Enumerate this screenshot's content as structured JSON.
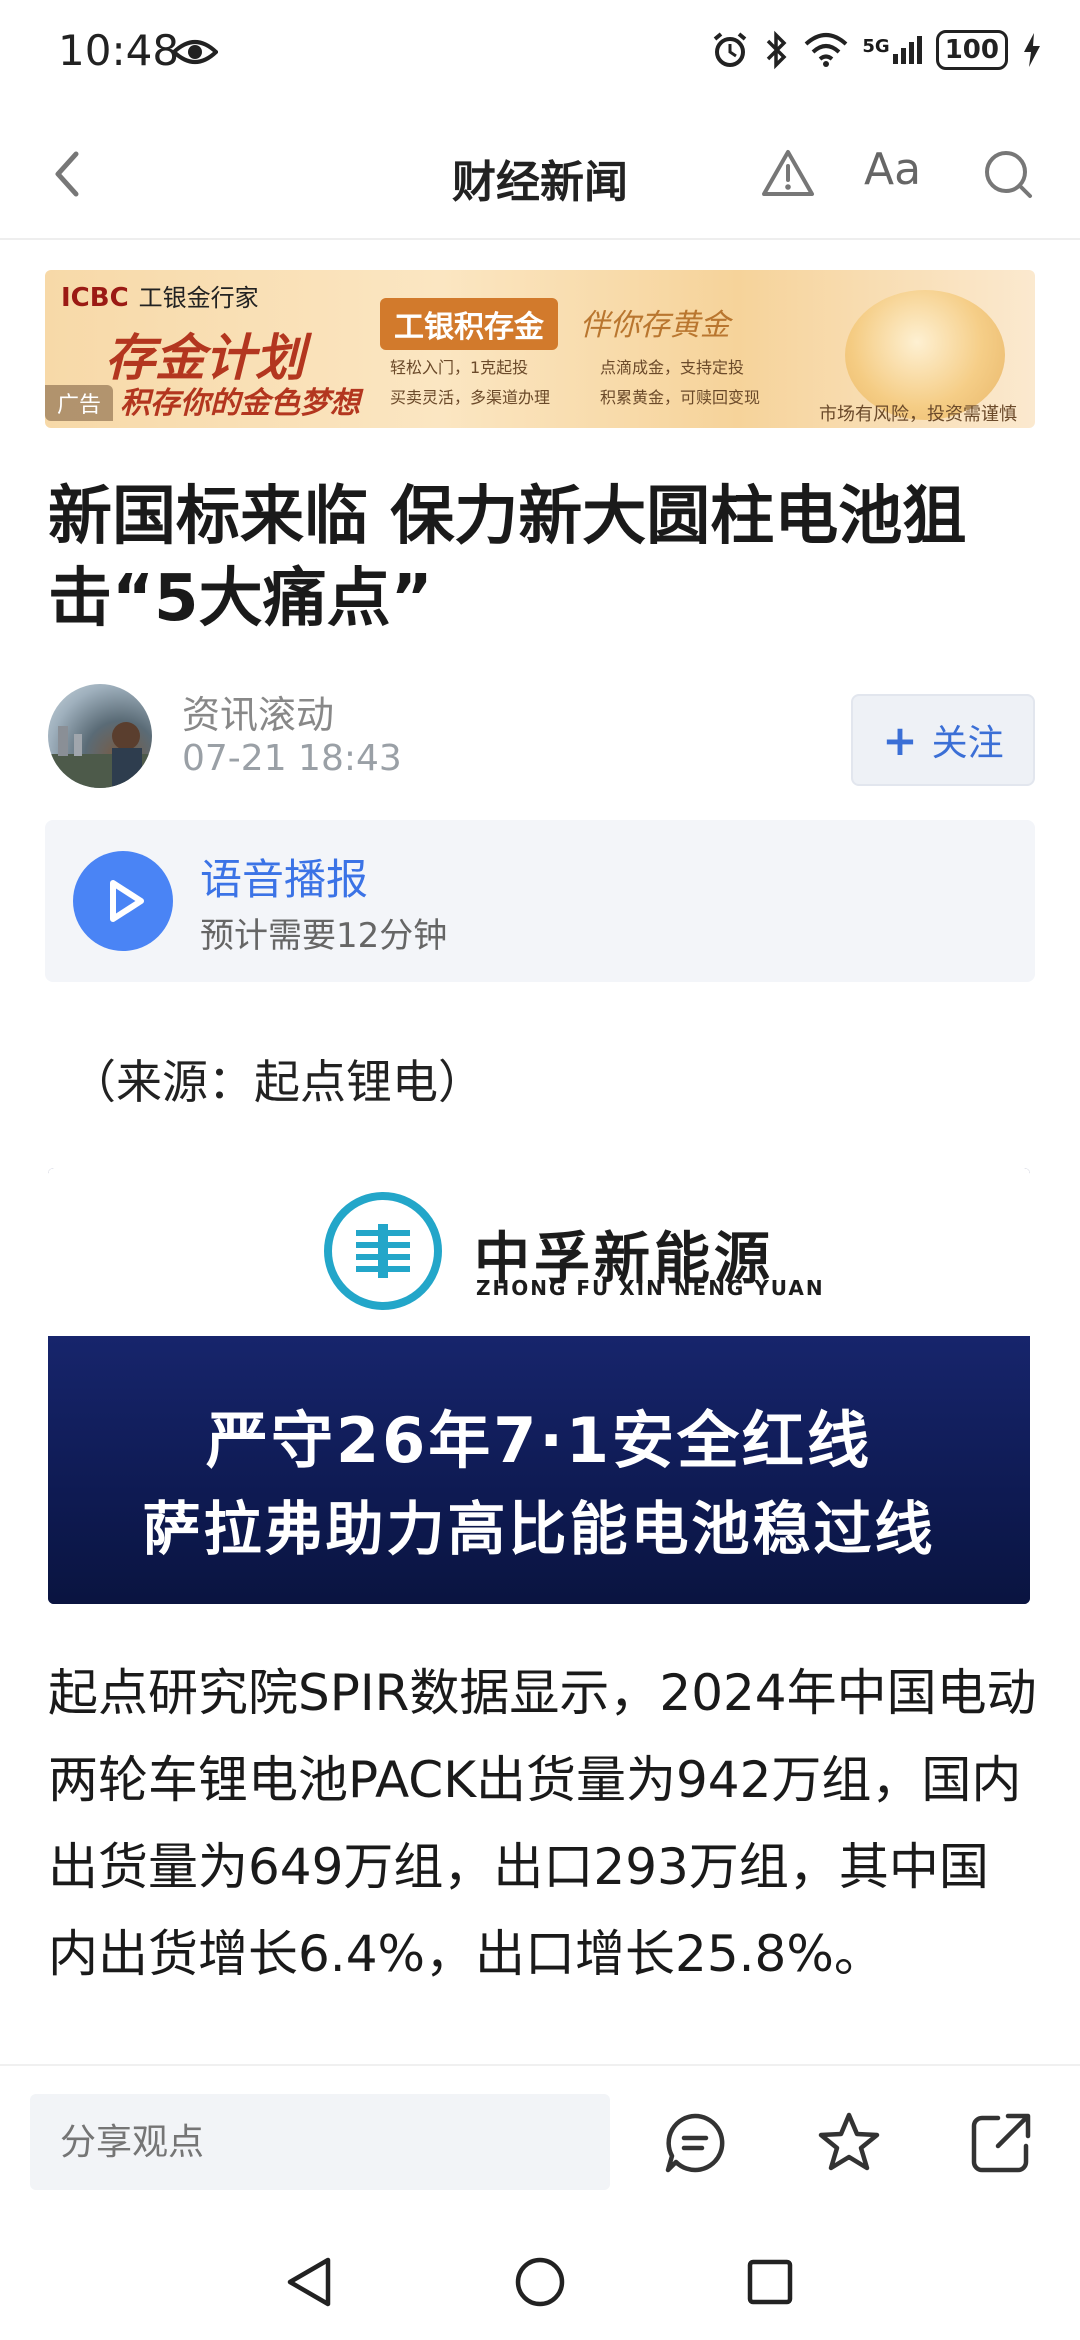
{
  "status_bar": {
    "time": "10:48",
    "network": "5G",
    "battery": "100"
  },
  "header": {
    "title": "财经新闻",
    "font_button": "Aa"
  },
  "ad": {
    "brand_en": "ICBC",
    "brand_cn": "工银金行家",
    "headline": "存金计划",
    "subline": "积存你的金色梦想",
    "tag": "广告",
    "product": "工银积存金",
    "slogan": "伴你存黄金",
    "bullets": [
      "轻松入门，1克起投",
      "点滴成金，支持定投",
      "买卖灵活，多渠道办理",
      "积累黄金，可赎回变现"
    ],
    "risk_note": "市场有风险，投资需谨慎"
  },
  "article": {
    "title": "新国标来临 保力新大圆柱电池狙击“5大痛点”",
    "author": "资讯滚动",
    "time": "07-21 18:43",
    "follow_label": "关注",
    "source": "（来源：起点锂电）",
    "image": {
      "brand_cn": "中孚新能源",
      "brand_en": "ZHONG FU XIN NENG YUAN",
      "line1": "严守26年7·1安全红线",
      "line2": "萨拉弗助力高比能电池稳过线"
    },
    "body": "起点研究院SPIR数据显示，2024年中国电动两轮车锂电池PACK出货量为942万组，国内出货量为649万组，出口293万组，其中国内出货增长6.4%，出口增长25.8%。"
  },
  "audio": {
    "title": "语音播报",
    "subtitle": "预计需要12分钟"
  },
  "action_bar": {
    "comment_placeholder": "分享观点"
  }
}
